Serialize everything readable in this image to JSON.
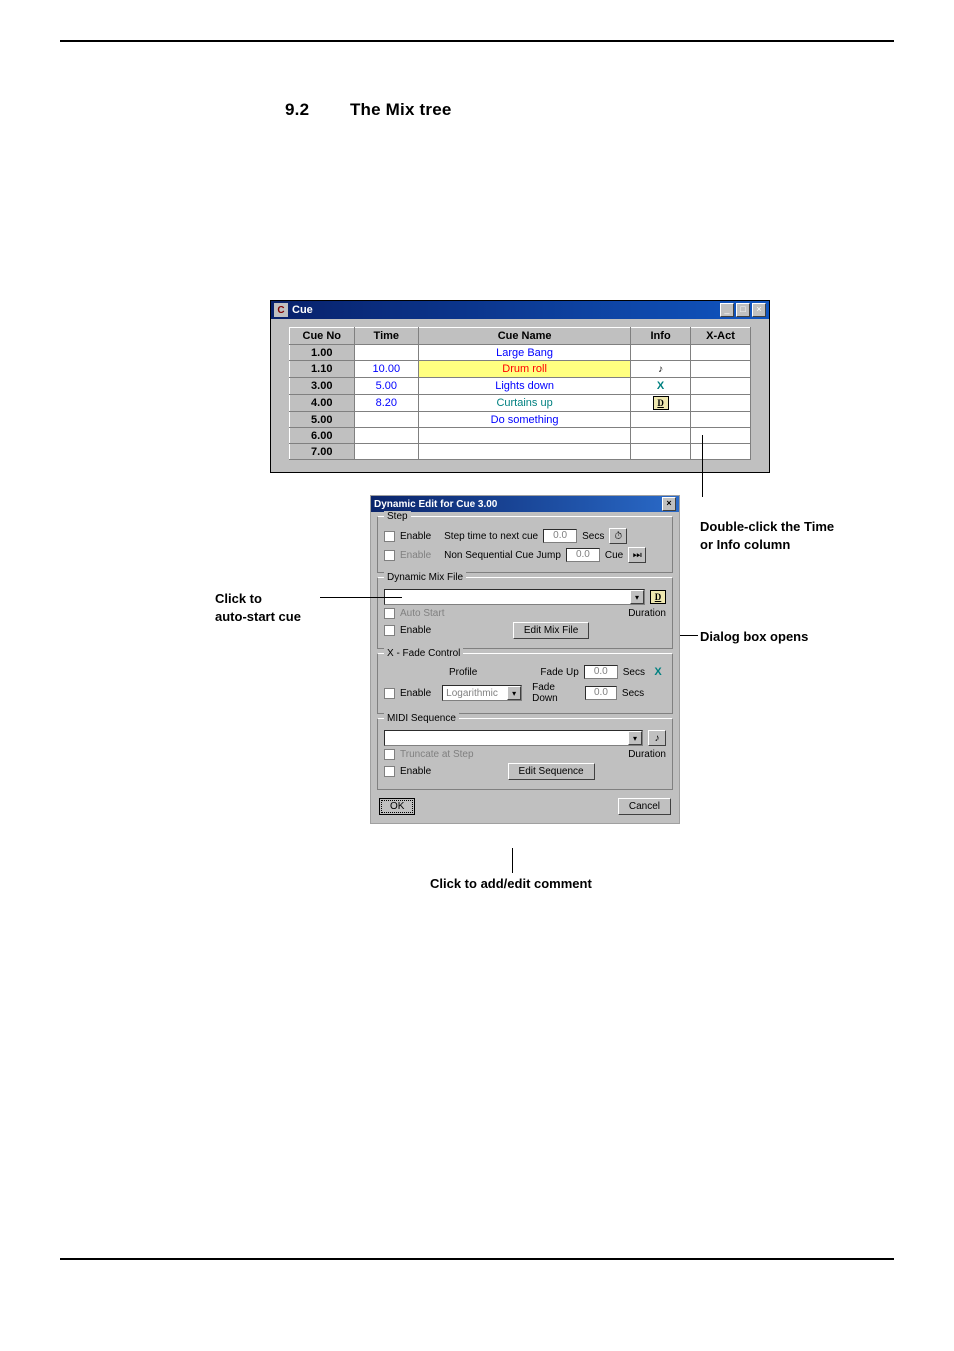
{
  "heading": {
    "number": "9.2",
    "title": "The Mix tree"
  },
  "cue_window": {
    "title": "Cue",
    "icon_label": "C",
    "win_buttons": {
      "min": "_",
      "max": "□",
      "close": "×"
    },
    "columns": [
      "Cue No",
      "Time",
      "Cue Name",
      "Info",
      "X-Act"
    ],
    "rows": [
      {
        "no": "1.00",
        "time": "",
        "name": "Large Bang",
        "name_class": "name-blue",
        "info": "",
        "sel": false
      },
      {
        "no": "1.10",
        "time": "10.00",
        "name": "Drum roll",
        "name_class": "name-red",
        "info": "midi",
        "sel": true
      },
      {
        "no": "3.00",
        "time": "5.00",
        "name": "Lights down",
        "name_class": "name-blue",
        "info": "x",
        "sel": false
      },
      {
        "no": "4.00",
        "time": "8.20",
        "name": "Curtains up",
        "name_class": "name-teal",
        "info": "d",
        "sel": false
      },
      {
        "no": "5.00",
        "time": "",
        "name": "Do something",
        "name_class": "name-blue",
        "info": "",
        "sel": false
      },
      {
        "no": "6.00",
        "time": "",
        "name": "",
        "name_class": "",
        "info": "",
        "sel": false
      },
      {
        "no": "7.00",
        "time": "",
        "name": "",
        "name_class": "",
        "info": "",
        "sel": false
      }
    ]
  },
  "dialog": {
    "title": "Dynamic Edit for Cue 3.00",
    "close": "×",
    "step": {
      "legend": "Step",
      "enable": "Enable",
      "step_time_label": "Step time to next cue",
      "step_time_val": "0.0",
      "step_time_units": "Secs",
      "enable_jump": "Enable",
      "jump_label": "Non Sequential Cue Jump",
      "jump_val": "0.0",
      "jump_units": "Cue"
    },
    "mixfile": {
      "legend": "Dynamic Mix File",
      "autostart": "Auto Start",
      "duration_label": "Duration",
      "enable": "Enable",
      "edit_btn": "Edit Mix File",
      "icon": "D"
    },
    "xfade": {
      "legend": "X - Fade Control",
      "profile_label": "Profile",
      "profile_value": "Logarithmic",
      "fadeup_label": "Fade Up",
      "fadeup_val": "0.0",
      "fadedown_label": "Fade Down",
      "fadedown_val": "0.0",
      "secs": "Secs",
      "enable": "Enable",
      "icon": "X"
    },
    "midi": {
      "legend": "MIDI Sequence",
      "truncate": "Truncate at Step",
      "duration_label": "Duration",
      "enable": "Enable",
      "edit_btn": "Edit Sequence",
      "icon": "♪"
    },
    "ok": "OK",
    "cancel": "Cancel"
  },
  "callouts": {
    "left": "Click to\nauto-start cue",
    "right_top": "Double-click the Time\nor Info column",
    "right_mid": "Dialog box opens",
    "bottom": "Click to add/edit comment"
  }
}
